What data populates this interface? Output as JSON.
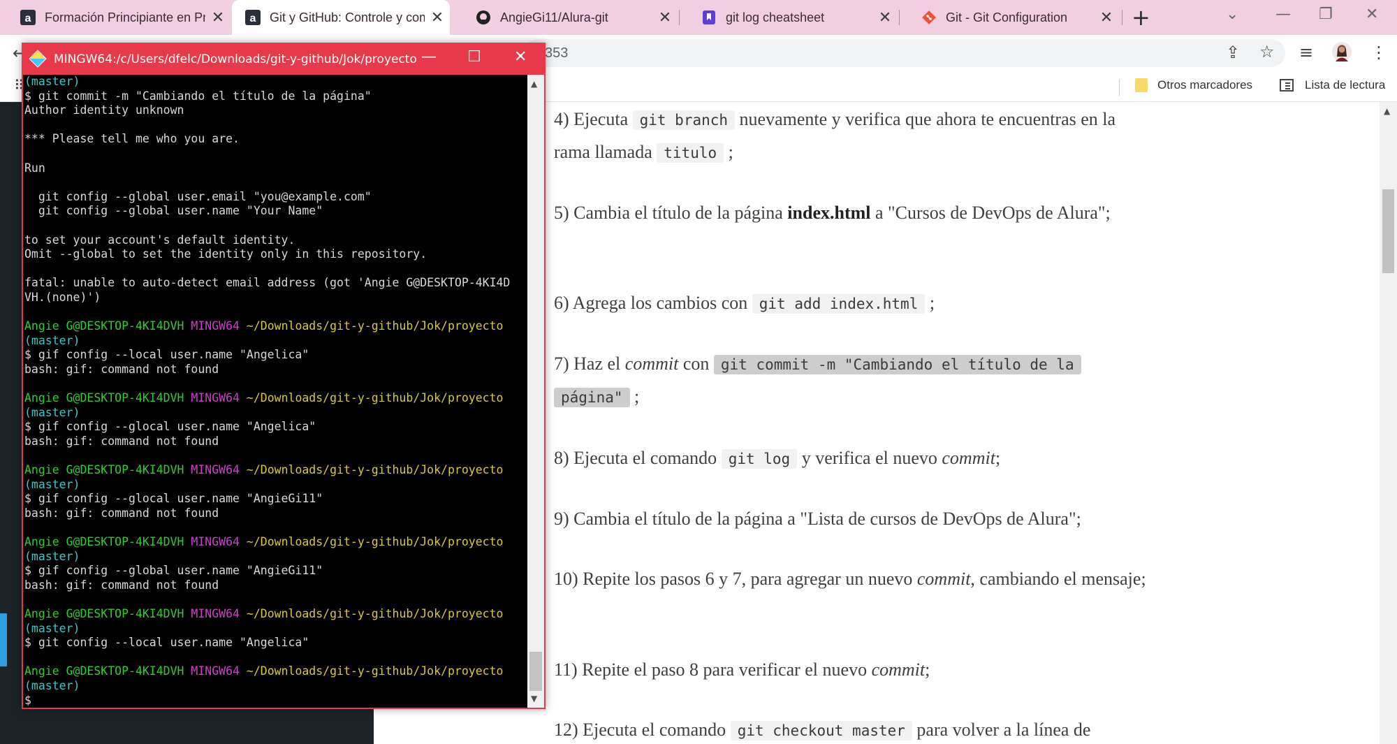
{
  "browser": {
    "tabs": [
      {
        "title": "Formación Principiante en Pr",
        "icon": "alura-icon",
        "active": false
      },
      {
        "title": "Git y GitHub: Controle y com",
        "icon": "alura-icon",
        "active": true
      },
      {
        "title": "AngieGi11/Alura-git",
        "icon": "github-icon",
        "active": false
      },
      {
        "title": "git log cheatsheet",
        "icon": "bookmark-icon",
        "active": false
      },
      {
        "title": "Git - Git Configuration",
        "icon": "git-icon",
        "active": false
      }
    ],
    "url_fragment": "353",
    "bookmarks": {
      "other": "Otros marcadores",
      "reading_list": "Lista de lectura"
    }
  },
  "terminal": {
    "title": "MINGW64:/c/Users/dfelc/Downloads/git-y-github/Jok/proyecto",
    "prompt": {
      "user": "Angie G@DESKTOP-4KI4DVH",
      "shell": "MINGW64",
      "path": "~/Downloads/git-y-github/Jok/proyecto",
      "branch": "(master)"
    },
    "lines": {
      "top_branch": "(master)",
      "cmd1": "$ git commit -m \"Cambiando el título de la página\"",
      "out1": "Author identity unknown",
      "out2": "*** Please tell me who you are.",
      "out3": "Run",
      "out4": "  git config --global user.email \"you@example.com\"",
      "out5": "  git config --global user.name \"Your Name\"",
      "out6": "to set your account's default identity.",
      "out7": "Omit --global to set the identity only in this repository.",
      "out8": "fatal: unable to auto-detect email address (got 'Angie G@DESKTOP-4KI4D",
      "out9": "VH.(none)')",
      "cmd2": "$ gif config --local user.name \"Angelica\"",
      "err2": "bash: gif: command not found",
      "cmd3": "$ gif config --glocal user.name \"Angelica\"",
      "err3": "bash: gif: command not found",
      "cmd4": "$ gif config --glocal user.name \"AngieGi11\"",
      "err4": "bash: gif: command not found",
      "cmd5": "$ gif config --global user.name \"AngieGi11\"",
      "err5": "bash: gif: command not found",
      "cmd6": "$ git config --local user.name \"Angelica\"",
      "cmd7": "$"
    }
  },
  "article": {
    "step4": {
      "a": "4) Ejecuta ",
      "code1": "git branch",
      "b": " nuevamente y verifica que ahora te encuentras en la rama llamada ",
      "code2": "titulo",
      "c": " ;"
    },
    "step5": {
      "a": "5) Cambia el título de la página ",
      "bold": "index.html",
      "b": " a \"Cursos de DevOps de Alura\";"
    },
    "step6": {
      "a": "6) Agrega los cambios con ",
      "code": "git add index.html",
      "b": " ;"
    },
    "step7": {
      "a": "7) Haz el ",
      "em": "commit",
      "b": " con ",
      "code1": "git commit -m \"Cambiando el título de la",
      "code2": "página\"",
      "c": " ;"
    },
    "step8": {
      "a": "8) Ejecuta el comando ",
      "code": "git log",
      "b": " y verifica el nuevo ",
      "em": "commit",
      "c": ";"
    },
    "step9": {
      "text": "9) Cambia el título de la página a \"Lista de cursos de DevOps de Alura\";"
    },
    "step10": {
      "a": "10) Repite los pasos 6 y 7, para agregar un nuevo ",
      "em": "commit",
      "b": ", cambiando el mensaje;"
    },
    "step11": {
      "a": "11) Repite el paso 8 para verificar el nuevo ",
      "em": "commit",
      "b": ";"
    },
    "step12": {
      "a": "12) Ejecuta el comando ",
      "code": "git checkout master",
      "b": " para volver a la línea de"
    }
  },
  "colors": {
    "tabstrip": "#f2cfe0",
    "terminal_frame": "#e8394a",
    "prompt_user": "#32cc32",
    "prompt_shell": "#d23cd2",
    "prompt_path": "#d8c83c",
    "prompt_branch": "#3cc8c8"
  }
}
